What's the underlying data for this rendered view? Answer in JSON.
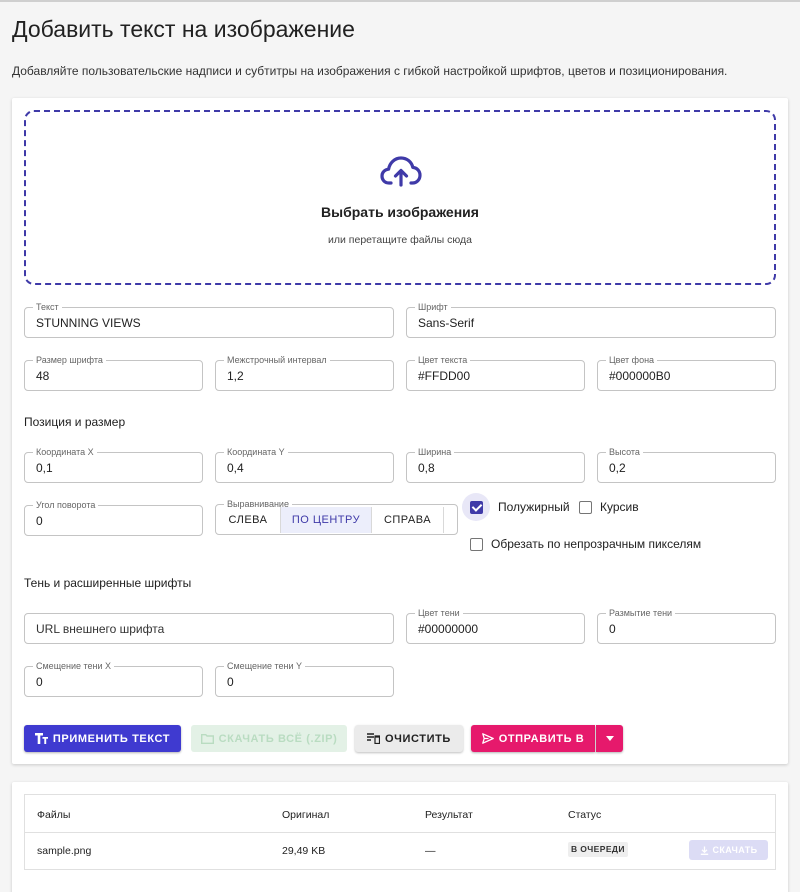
{
  "header": {
    "title": "Добавить текст на изображение",
    "description": "Добавляйте пользовательские надписи и субтитры на изображения с гибкой настройкой шрифтов, цветов и позиционирования."
  },
  "dropzone": {
    "title": "Выбрать изображения",
    "subtitle": "или перетащите файлы сюда",
    "icon": "cloud-upload-icon",
    "accent": "#3f3aa8"
  },
  "text_settings": {
    "text": {
      "label": "Текст",
      "value": "STUNNING VIEWS"
    },
    "font": {
      "label": "Шрифт",
      "value": "Sans-Serif"
    },
    "font_size": {
      "label": "Размер шрифта",
      "value": "48"
    },
    "line_height": {
      "label": "Межстрочный интервал",
      "value": "1,2"
    },
    "text_color": {
      "label": "Цвет текста",
      "value": "#FFDD00"
    },
    "bg_color": {
      "label": "Цвет фона",
      "value": "#000000B0"
    }
  },
  "position": {
    "section_title": "Позиция и размер",
    "x": {
      "label": "Координата X",
      "value": "0,1"
    },
    "y": {
      "label": "Координата Y",
      "value": "0,4"
    },
    "width": {
      "label": "Ширина",
      "value": "0,8"
    },
    "height": {
      "label": "Высота",
      "value": "0,2"
    },
    "rotation": {
      "label": "Угол поворота",
      "value": "0"
    },
    "alignment": {
      "label": "Выравнивание",
      "options": [
        "СЛЕВА",
        "ПО ЦЕНТРУ",
        "СПРАВА"
      ],
      "selected": "ПО ЦЕНТРУ"
    },
    "bold": {
      "label": "Полужирный",
      "checked": true
    },
    "italic": {
      "label": "Курсив",
      "checked": false
    },
    "crop": {
      "label": "Обрезать по непрозрачным пикселям",
      "checked": false
    }
  },
  "shadow": {
    "section_title": "Тень и расширенные шрифты",
    "font_url": {
      "placeholder": "URL внешнего шрифта"
    },
    "shadow_color": {
      "label": "Цвет тени",
      "value": "#00000000"
    },
    "shadow_blur": {
      "label": "Размытие тени",
      "value": "0"
    },
    "offset_x": {
      "label": "Смещение тени X",
      "value": "0"
    },
    "offset_y": {
      "label": "Смещение тени Y",
      "value": "0"
    }
  },
  "actions": {
    "apply": "ПРИМЕНИТЬ ТЕКСТ",
    "download_zip": "СКАЧАТЬ ВСЁ (.ZIP)",
    "clear": "ОЧИСТИТЬ",
    "send": "ОТПРАВИТЬ В",
    "colors": {
      "primary": "#3f3ad0",
      "send": "#e6196c",
      "zip_disabled": "#e3f1e6"
    }
  },
  "files_table": {
    "columns": [
      "Файлы",
      "Оригинал",
      "Результат",
      "Статус"
    ],
    "rows": [
      {
        "file": "sample.png",
        "original": "29,49 KB",
        "result": "—",
        "status": "В ОЧЕРЕДИ",
        "action": "СКАЧАТЬ"
      }
    ]
  }
}
